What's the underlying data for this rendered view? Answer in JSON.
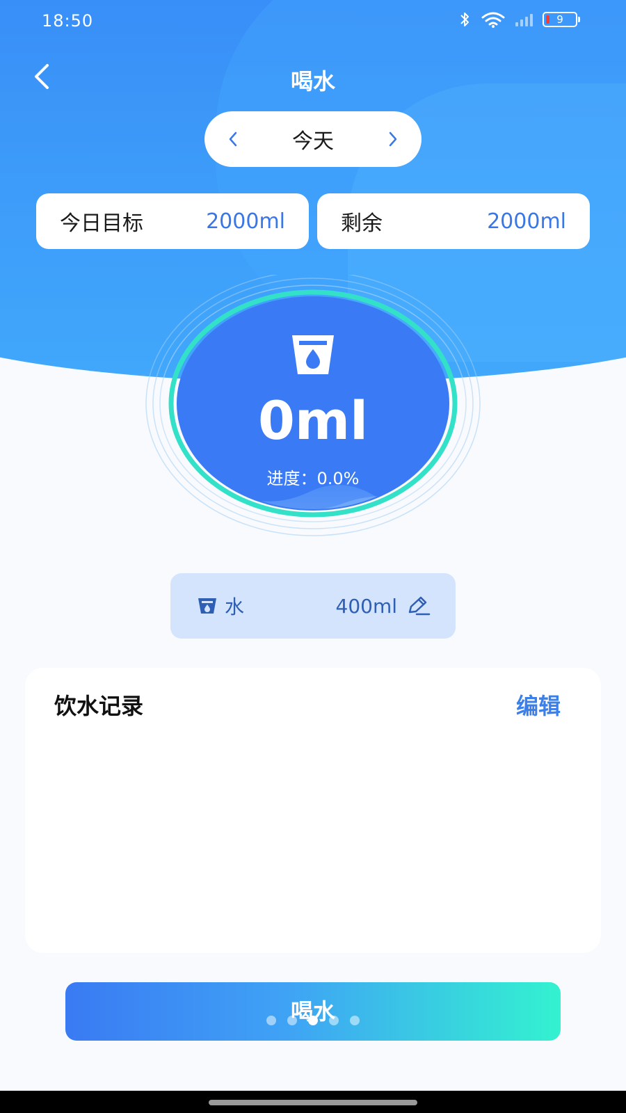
{
  "status_bar": {
    "time": "18:50",
    "battery_level": "9",
    "icons": [
      "bluetooth-icon",
      "wifi-icon",
      "signal-icon",
      "battery-icon"
    ]
  },
  "header": {
    "title": "喝水",
    "back_icon": "chevron-left-icon"
  },
  "date_selector": {
    "label": "今天",
    "prev_icon": "chevron-left-icon",
    "next_icon": "chevron-right-icon"
  },
  "stats": {
    "goal_label": "今日目标",
    "goal_value": "2000ml",
    "remaining_label": "剩余",
    "remaining_value": "2000ml"
  },
  "progress": {
    "amount": "0ml",
    "progress_label": "进度：",
    "progress_value": "0.0%",
    "fraction": 0.0,
    "icon": "water-cup-icon"
  },
  "drink_selector": {
    "name": "水",
    "amount": "400ml",
    "icon": "water-cup-icon",
    "edit_icon": "pencil-icon"
  },
  "records": {
    "title": "饮水记录",
    "edit_label": "编辑",
    "items": []
  },
  "action": {
    "drink_button_label": "喝水"
  },
  "colors": {
    "primary": "#3a77e6",
    "header_gradient_top": "#2f7bf6",
    "ring_accent": "#33e0c8",
    "circle_fill": "#3b7af5",
    "drink_chip_bg": "#d3e4fc",
    "button_gradient_start": "#3a7af3",
    "button_gradient_end": "#33f2d0"
  },
  "pager": {
    "count": 5,
    "active_index": 2
  }
}
